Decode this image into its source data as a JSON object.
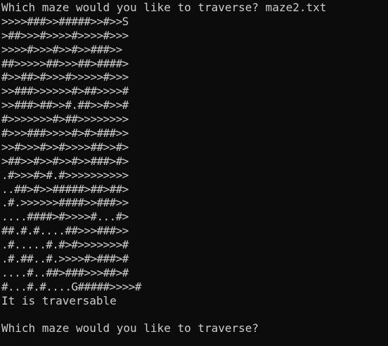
{
  "console": {
    "prompt1": "Which maze would you like to traverse? maze2.txt",
    "maze_rows": [
      ">>>>###>>#####>>#>>S",
      ">##>>>#>>>>#>>>>#>>>",
      ">>>>#>>>#>>#>>###>>",
      "##>>>>>##>>>##>####>",
      "#>>##>#>>>#>>>>>#>>>",
      ">>###>>>>>>#>##>>>>#",
      ">>###>##>>#.##>>#>>#",
      "#>>>>>>>#>##>>>>>>>>",
      "#>>>###>>>>#>#>###>>",
      ">>#>>>#>>#>>>>##>>#>",
      ">##>>#>>#>>#>>###>#>",
      ".#>>>#>#.#>>>>>>>>>>",
      "..##>#>>#####>##>##>",
      ".#.>>>>>>####>>###>>",
      "....####>#>>>>#...#>",
      "##.#.#....##>>>###>>",
      ".#.....#.#>#>>>>>>>#",
      ".#.##..#.>>>>#>###>#",
      "....#..##>###>>>##>#",
      "#...#.#....G#####>>>>#"
    ],
    "result": "It is traversable",
    "blank": "",
    "prompt2": "Which maze would you like to traverse?"
  }
}
